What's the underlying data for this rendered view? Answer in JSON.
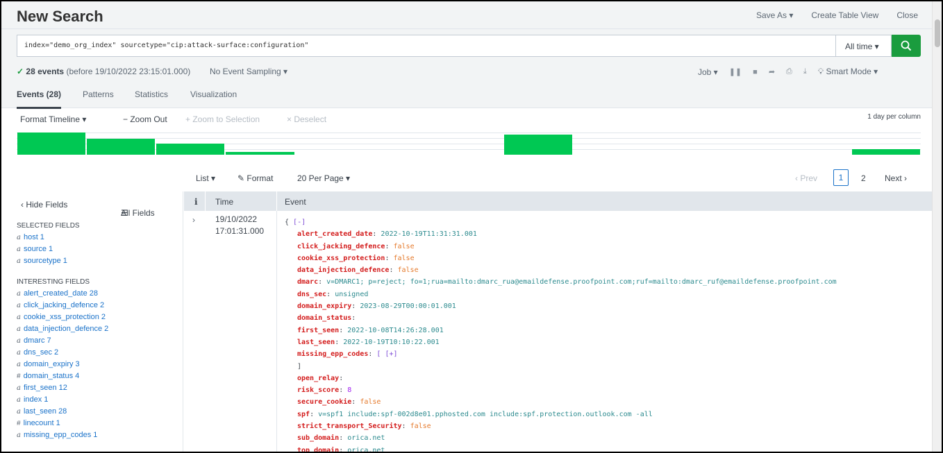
{
  "header": {
    "title": "New Search",
    "save_as": "Save As ▾",
    "create_table_view": "Create Table View",
    "close": "Close"
  },
  "search": {
    "query": "index=\"demo_org_index\" sourcetype=\"cip:attack-surface:configuration\"",
    "time_range": "All time ▾"
  },
  "status": {
    "check": "✓",
    "count": "28 events",
    "before": "(before 19/10/2022 23:15:01.000)",
    "sampling": "No Event Sampling ▾",
    "job": "Job ▾",
    "mode": "Smart Mode ▾"
  },
  "tabs": [
    "Events (28)",
    "Patterns",
    "Statistics",
    "Visualization"
  ],
  "timeline": {
    "format": "Format Timeline ▾",
    "zoom_out": "− Zoom Out",
    "zoom_to_selection": "+ Zoom to Selection",
    "deselect": "× Deselect",
    "scale": "1 day per column",
    "columns": [
      1,
      0.72,
      0.5,
      0.12,
      0,
      0,
      0,
      0.92,
      0,
      0,
      0,
      0,
      0.25
    ]
  },
  "results_toolbar": {
    "list": "List ▾",
    "format": "Format",
    "per_page": "20 Per Page ▾",
    "prev": "‹ Prev",
    "pages": [
      "1",
      "2"
    ],
    "next": "Next ›"
  },
  "sidebar": {
    "hide_fields": "‹ Hide Fields",
    "all_fields": "All Fields",
    "selected_title": "SELECTED FIELDS",
    "selected": [
      {
        "type": "a",
        "name": "host",
        "count": "1"
      },
      {
        "type": "a",
        "name": "source",
        "count": "1"
      },
      {
        "type": "a",
        "name": "sourcetype",
        "count": "1"
      }
    ],
    "interesting_title": "INTERESTING FIELDS",
    "interesting": [
      {
        "type": "a",
        "name": "alert_created_date",
        "count": "28"
      },
      {
        "type": "a",
        "name": "click_jacking_defence",
        "count": "2"
      },
      {
        "type": "a",
        "name": "cookie_xss_protection",
        "count": "2"
      },
      {
        "type": "a",
        "name": "data_injection_defence",
        "count": "2"
      },
      {
        "type": "a",
        "name": "dmarc",
        "count": "7"
      },
      {
        "type": "a",
        "name": "dns_sec",
        "count": "2"
      },
      {
        "type": "a",
        "name": "domain_expiry",
        "count": "3"
      },
      {
        "type": "#",
        "name": "domain_status",
        "count": "4"
      },
      {
        "type": "a",
        "name": "first_seen",
        "count": "12"
      },
      {
        "type": "a",
        "name": "index",
        "count": "1"
      },
      {
        "type": "a",
        "name": "last_seen",
        "count": "28"
      },
      {
        "type": "#",
        "name": "linecount",
        "count": "1"
      },
      {
        "type": "a",
        "name": "missing_epp_codes",
        "count": "1"
      }
    ]
  },
  "events_table": {
    "col_i": "i",
    "col_time": "Time",
    "col_event": "Event",
    "expand": "›",
    "time_date": "19/10/2022",
    "time_clock": "17:01:31.000",
    "open_brace": "{ ",
    "collapse": "[-]",
    "fields": [
      {
        "key": "alert_created_date",
        "value": "2022-10-19T11:31:31.001",
        "kind": "s"
      },
      {
        "key": "click_jacking_defence",
        "value": "false",
        "kind": "b"
      },
      {
        "key": "cookie_xss_protection",
        "value": "false",
        "kind": "b"
      },
      {
        "key": "data_injection_defence",
        "value": "false",
        "kind": "b"
      },
      {
        "key": "dmarc",
        "value": "v=DMARC1; p=reject; fo=1;rua=mailto:dmarc_rua@emaildefense.proofpoint.com;ruf=mailto:dmarc_ruf@emaildefense.proofpoint.com",
        "kind": "s"
      },
      {
        "key": "dns_sec",
        "value": "unsigned",
        "kind": "s"
      },
      {
        "key": "domain_expiry",
        "value": "2023-08-29T00:00:01.001",
        "kind": "s"
      },
      {
        "key": "domain_status",
        "value": "",
        "kind": "s"
      },
      {
        "key": "first_seen",
        "value": "2022-10-08T14:26:28.001",
        "kind": "s"
      },
      {
        "key": "last_seen",
        "value": "2022-10-19T10:10:22.001",
        "kind": "s"
      },
      {
        "key": "missing_epp_codes",
        "value": "[ [+]",
        "kind": "arr"
      },
      {
        "key": "",
        "value": "]",
        "kind": "close"
      },
      {
        "key": "open_relay",
        "value": "",
        "kind": "s"
      },
      {
        "key": "risk_score",
        "value": "8",
        "kind": "n"
      },
      {
        "key": "secure_cookie",
        "value": "false",
        "kind": "b"
      },
      {
        "key": "spf",
        "value": "v=spf1 include:spf-002d8e01.pphosted.com include:spf.protection.outlook.com -all",
        "kind": "s"
      },
      {
        "key": "strict_transport_Security",
        "value": "false",
        "kind": "b"
      },
      {
        "key": "sub_domain",
        "value": "orica.net",
        "kind": "s"
      },
      {
        "key": "top_domain",
        "value": "orica.net",
        "kind": "s"
      }
    ]
  },
  "colors": {
    "accent_green": "#1a9c3e",
    "timeline_bar": "#00c853",
    "link_blue": "#1a72c9",
    "key_red": "#d31c1c"
  }
}
